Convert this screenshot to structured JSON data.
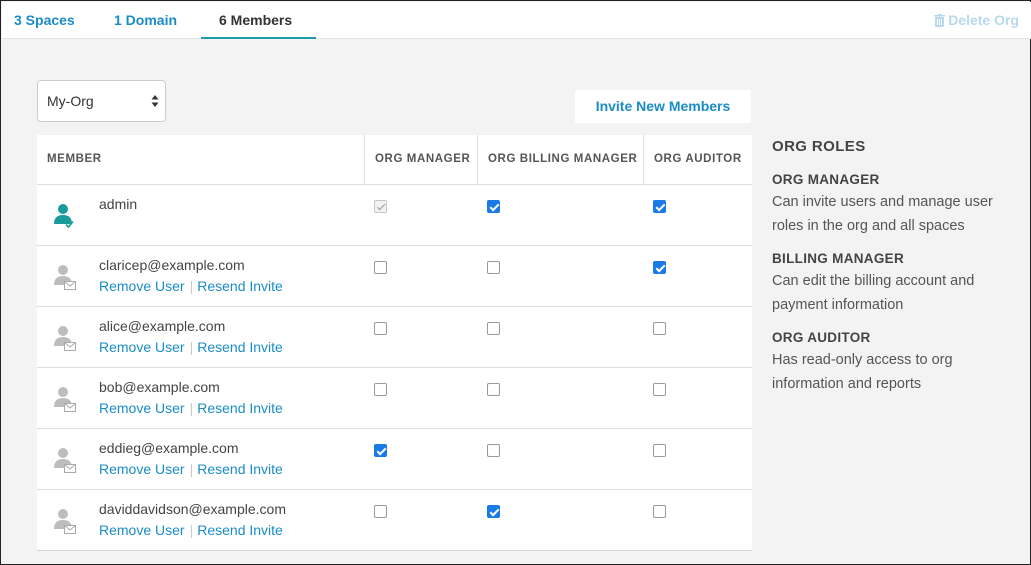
{
  "tabs": [
    {
      "label": "3 Spaces",
      "active": false
    },
    {
      "label": "1 Domain",
      "active": false
    },
    {
      "label": "6 Members",
      "active": true
    }
  ],
  "delete_org": {
    "label": "Delete Org",
    "icon": "trash-icon"
  },
  "org_select": {
    "value": "My-Org"
  },
  "invite_button": {
    "label": "Invite New Members"
  },
  "table": {
    "headers": [
      "MEMBER",
      "ORG MANAGER",
      "ORG BILLING MANAGER",
      "ORG AUDITOR"
    ],
    "remove_label": "Remove User",
    "resend_label": "Resend Invite",
    "rows": [
      {
        "name": "admin",
        "type": "active-user",
        "org_manager": "disabled-checked",
        "billing_manager": true,
        "auditor": true
      },
      {
        "name": "claricep@example.com",
        "type": "invited",
        "org_manager": false,
        "billing_manager": false,
        "auditor": true
      },
      {
        "name": "alice@example.com",
        "type": "invited",
        "org_manager": false,
        "billing_manager": false,
        "auditor": false
      },
      {
        "name": "bob@example.com",
        "type": "invited",
        "org_manager": false,
        "billing_manager": false,
        "auditor": false
      },
      {
        "name": "eddieg@example.com",
        "type": "invited",
        "org_manager": true,
        "billing_manager": false,
        "auditor": false
      },
      {
        "name": "daviddavidson@example.com",
        "type": "invited",
        "org_manager": false,
        "billing_manager": true,
        "auditor": false
      }
    ]
  },
  "roles": {
    "title": "ORG ROLES",
    "items": [
      {
        "name": "ORG MANAGER",
        "description": "Can invite users and manage user roles in the org and all spaces"
      },
      {
        "name": "BILLING MANAGER",
        "description": "Can edit the billing account and payment information"
      },
      {
        "name": "ORG AUDITOR",
        "description": "Has read-only access to org information and reports"
      }
    ]
  },
  "colors": {
    "accent": "#1a8cc7",
    "tab_underline": "#1f9aa6",
    "checkbox": "#1a7ae6",
    "active_user": "#1a9b9b"
  }
}
